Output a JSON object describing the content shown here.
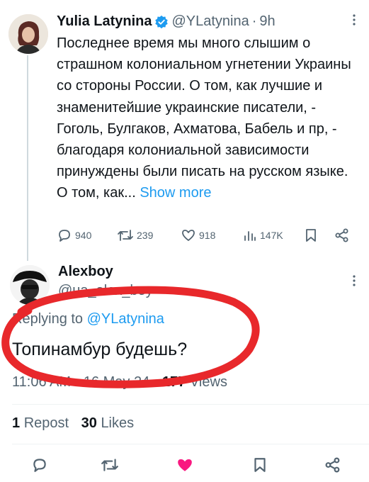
{
  "parent_tweet": {
    "author_name": "Yulia Latynina",
    "author_handle": "@YLatynina",
    "separator": "·",
    "time": "9h",
    "text": "Последнее время мы много слышим о страшном колониальном угнетении Украины со стороны России. О том, как лучшие и знаменитейшие украинские писатели, - Гоголь, Булгаков, Ахматова, Бабель и пр, - благодаря колониальной зависимости принуждены были писать на русском языке. О том, как...",
    "show_more_label": "Show more",
    "replies_count": "940",
    "reposts_count": "239",
    "likes_count": "918",
    "views_count": "147K"
  },
  "reply_tweet": {
    "author_name": "Alexboy",
    "author_handle": "@ua_alex_boy",
    "replying_prefix": "Replying to",
    "replying_handle": "@YLatynina",
    "text": "Топинамбур будешь?",
    "time": "11:06 AM",
    "meta_separator": "·",
    "date": "16 May 24",
    "views_count": "177",
    "views_label": "Views",
    "reposts_count": "1",
    "reposts_label": "Repost",
    "likes_count": "30",
    "likes_label": "Likes"
  },
  "colors": {
    "accent": "#1d9bf0",
    "secondary_text": "#536471",
    "liked_pink": "#f91880",
    "verified_badge": "#1d9bf0",
    "annotation_red": "#e8282b"
  },
  "icons": [
    "more-icon",
    "verified-badge-icon",
    "reply-icon",
    "repost-icon",
    "like-icon",
    "views-icon",
    "bookmark-icon",
    "share-icon"
  ]
}
